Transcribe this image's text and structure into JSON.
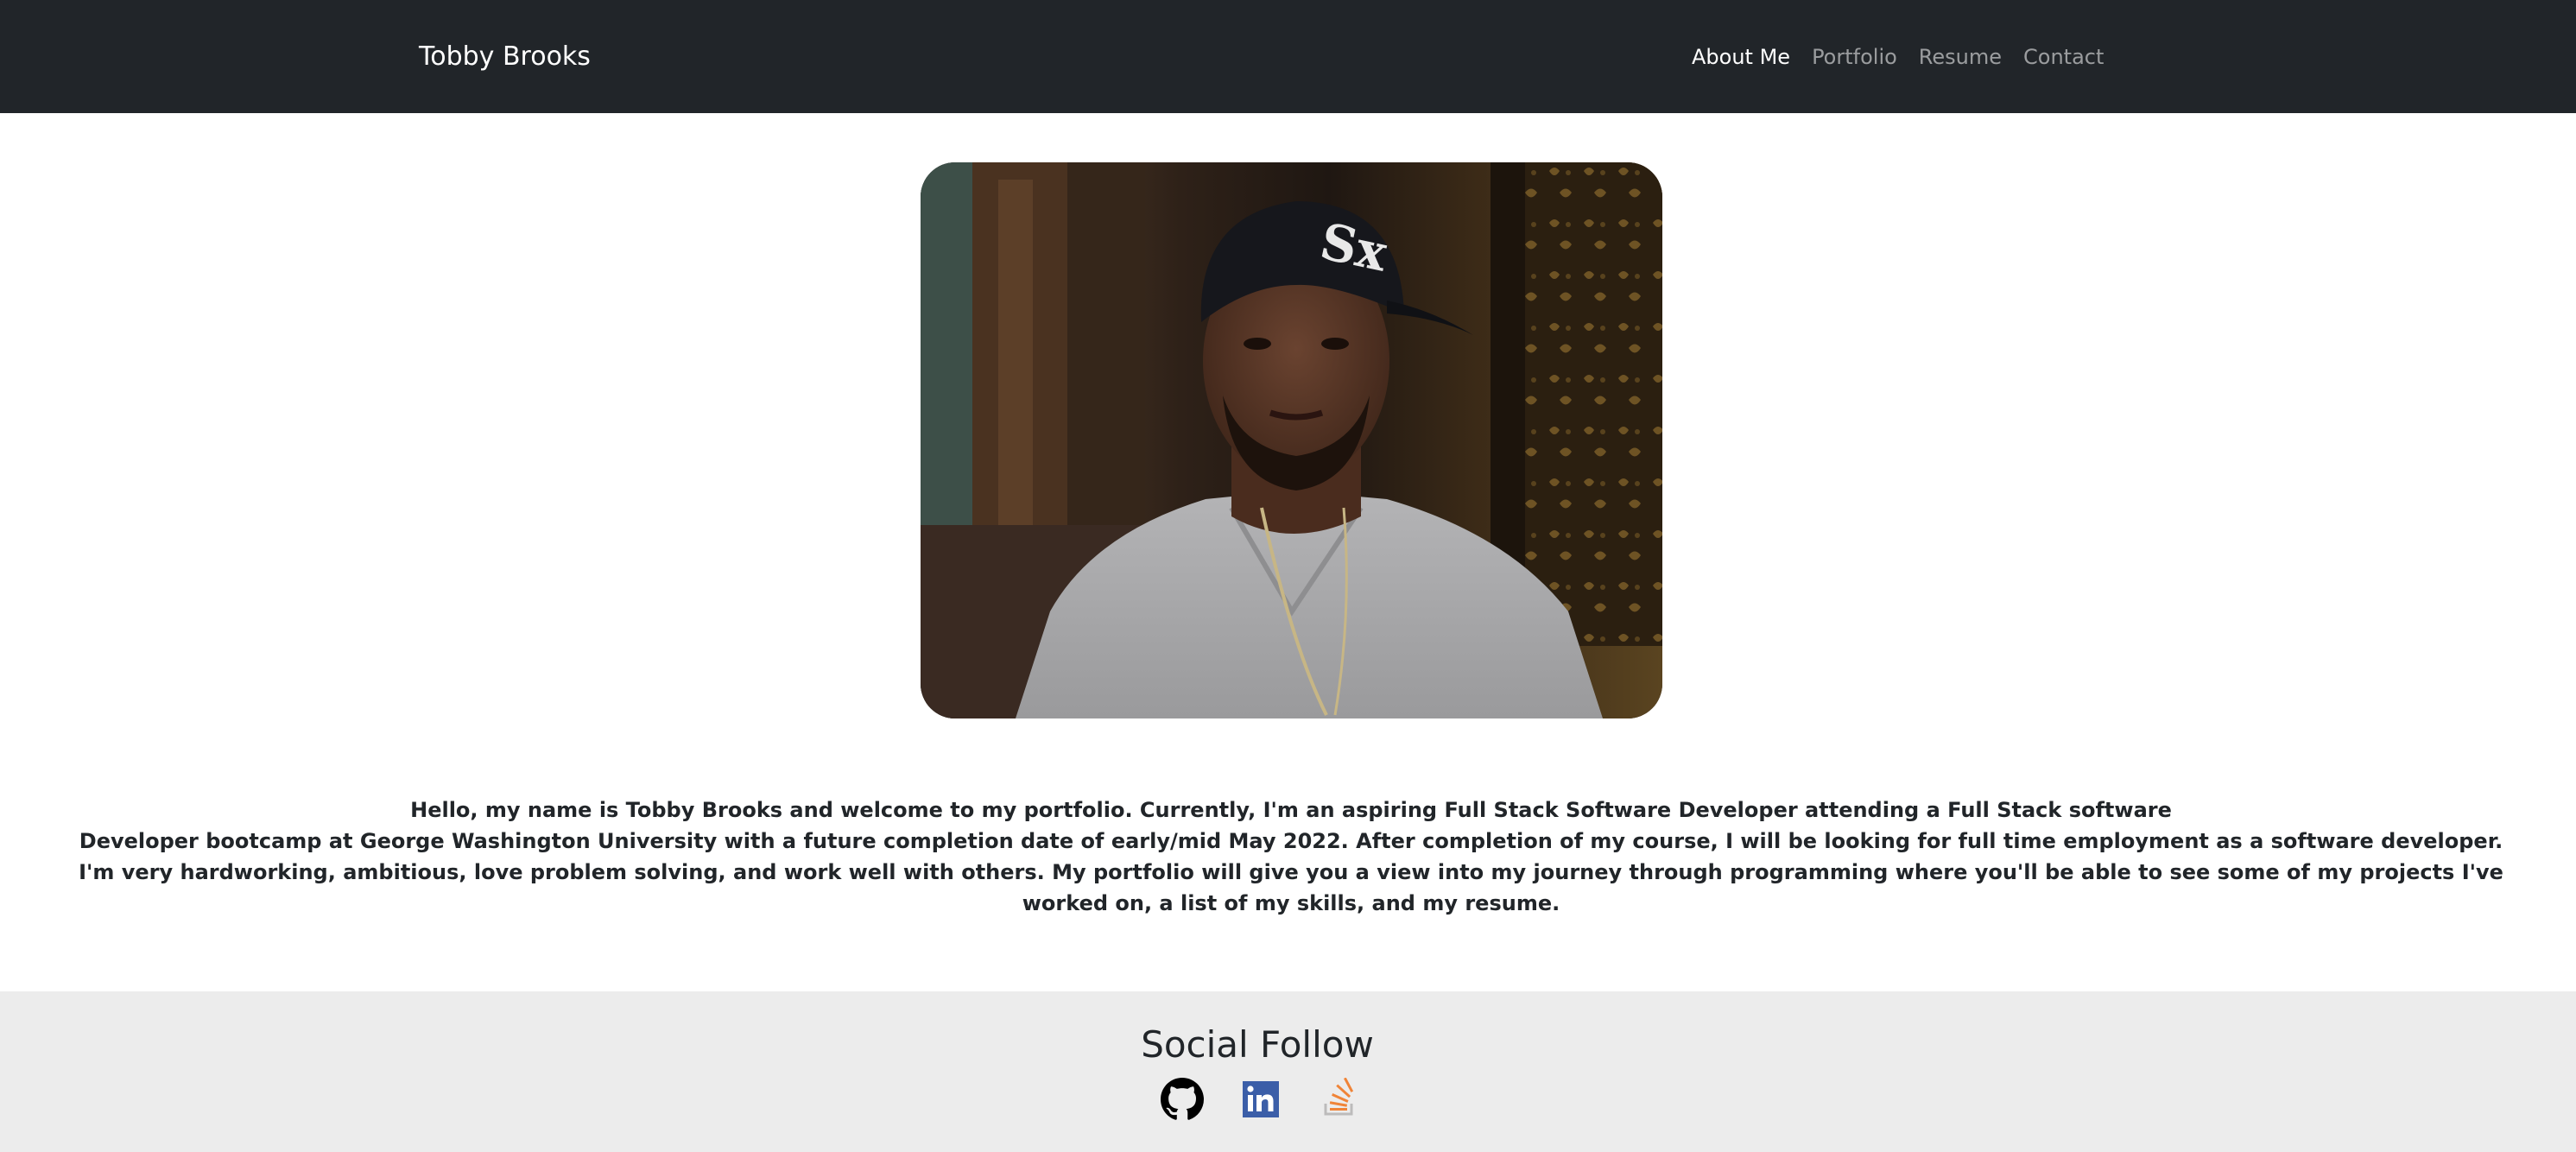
{
  "navbar": {
    "brand": "Tobby Brooks",
    "links": [
      {
        "label": "About Me",
        "active": true
      },
      {
        "label": "Portfolio",
        "active": false
      },
      {
        "label": "Resume",
        "active": false
      },
      {
        "label": "Contact",
        "active": false
      }
    ]
  },
  "profile": {
    "photo_icon": "profile-photo"
  },
  "bio": {
    "line1": "Hello, my name is Tobby Brooks and welcome to my portfolio. Currently, I'm an aspiring Full Stack Software Developer attending a Full Stack software",
    "line2": "Developer bootcamp at George Washington University with a future completion date of early/mid May 2022. After completion of my course, I will be looking for full time employment as a software developer.",
    "line3": "I'm very hardworking, ambitious, love problem solving, and work well with others. My portfolio will give you a view into my journey through programming where you'll be able to see some of my projects I've worked on, a list of my skills, and my resume."
  },
  "footer": {
    "title": "Social Follow",
    "socials": [
      {
        "icon": "github-icon",
        "color": "#000000"
      },
      {
        "icon": "linkedin-icon",
        "color": "#3b5ea8"
      },
      {
        "icon": "stackoverflow-icon",
        "color": "#f08438"
      }
    ]
  },
  "colors": {
    "navbar_bg": "#212529",
    "footer_bg": "#ececec",
    "text": "#212529"
  }
}
